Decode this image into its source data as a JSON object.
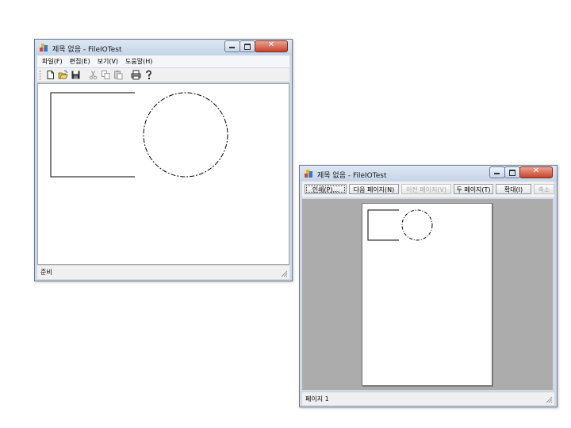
{
  "main_window": {
    "title": "제목 없음 - FileIOTest",
    "menus": [
      "파일(F)",
      "편집(E)",
      "보기(V)",
      "도움말(H)"
    ],
    "toolbar_icons": [
      "new-file-icon",
      "open-folder-icon",
      "save-icon",
      "cut-icon",
      "copy-icon",
      "paste-icon",
      "print-icon",
      "help-icon"
    ],
    "status": "준비"
  },
  "preview_window": {
    "title": "제목 없음 - FileIOTest",
    "buttons": [
      {
        "label": "인쇄(P)...",
        "enabled": true
      },
      {
        "label": "다음 페이지(N)",
        "enabled": true
      },
      {
        "label": "이전 페이지(V)",
        "enabled": false
      },
      {
        "label": "두 페이지(T)",
        "enabled": true
      },
      {
        "label": "확대(I)",
        "enabled": true
      },
      {
        "label": "축소",
        "enabled": false
      }
    ],
    "status": "페이지 1"
  },
  "colors": {
    "titlebar": "#cfd9e8",
    "close_button": "#c8432c",
    "preview_background": "#acacac"
  }
}
